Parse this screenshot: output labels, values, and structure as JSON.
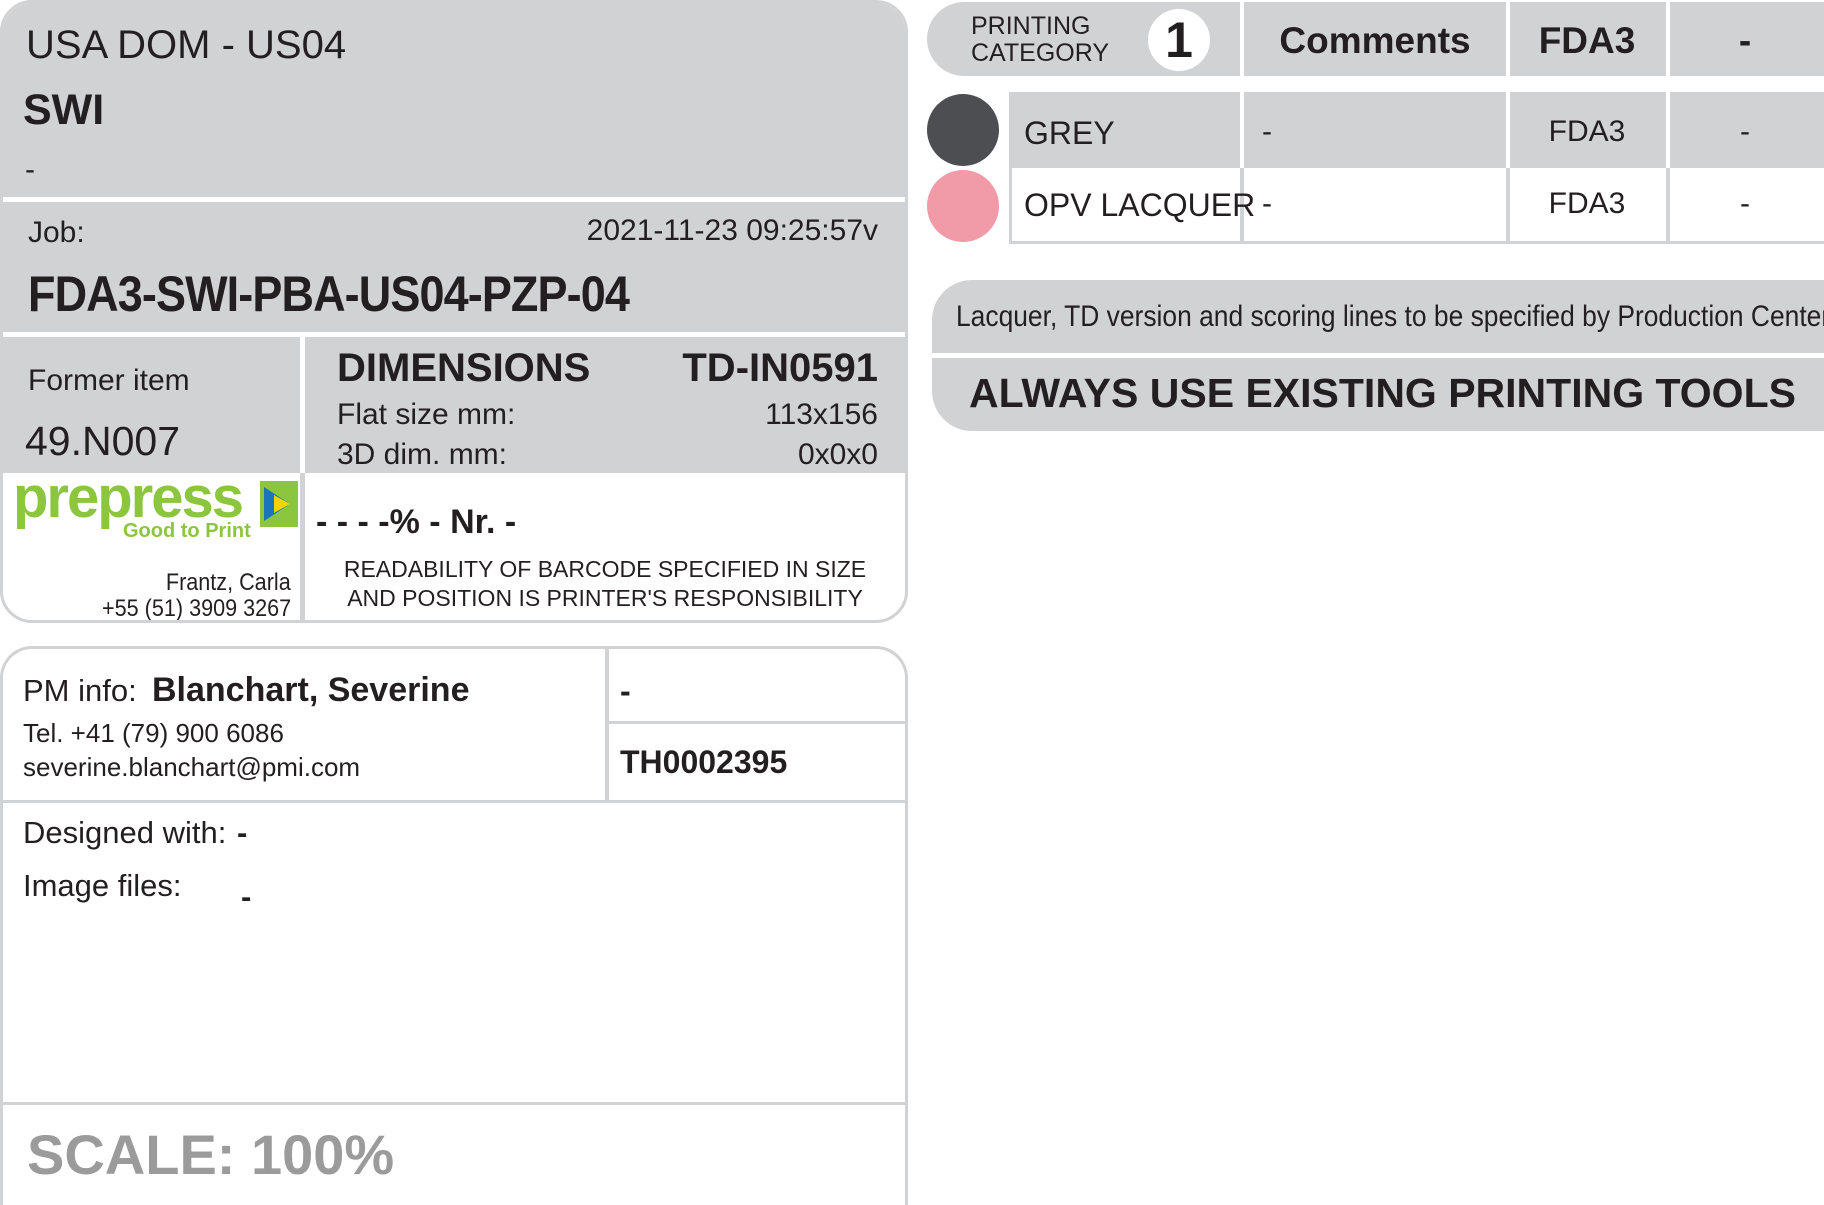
{
  "header": {
    "region": "USA DOM - US04",
    "brand": "SWI",
    "subtitle": "-"
  },
  "job": {
    "label": "Job:",
    "timestamp": "2021-11-23 09:25:57v",
    "code": "FDA3-SWI-PBA-US04-PZP-04"
  },
  "former_item": {
    "label": "Former item",
    "value": "49.N007"
  },
  "dimensions": {
    "title": "DIMENSIONS",
    "td_code": "TD-IN0591",
    "flat_label": "Flat size mm:",
    "flat_value": "113x156",
    "dim3d_label": "3D dim. mm:",
    "dim3d_value": "0x0x0"
  },
  "logo": {
    "word": "prepress",
    "tagline": "Good to Print",
    "brand_green": "#8cc63f",
    "brand_blue": "#1a75bb",
    "brand_yellow": "#f2d500"
  },
  "contact": {
    "name": "Frantz, Carla",
    "phone": "+55 (51) 3909 3267"
  },
  "barcode": {
    "spec": "- - - -% - Nr. -",
    "note_line1": "READABILITY OF BARCODE SPECIFIED IN SIZE",
    "note_line2": "AND POSITION IS PRINTER'S RESPONSIBILITY"
  },
  "pm": {
    "label": "PM info:",
    "name": "Blanchart, Severine",
    "tel": "Tel. +41 (79) 900 6086",
    "email": "severine.blanchart@pmi.com",
    "field1": "-",
    "field2": "TH0002395"
  },
  "design": {
    "designed_label": "Designed with:",
    "designed_value": "-",
    "image_label": "Image files:",
    "image_value": "-"
  },
  "scale": {
    "text": "SCALE: 100%"
  },
  "printing": {
    "category_line1": "PRINTING",
    "category_line2": "CATEGORY",
    "category_number": "1",
    "comments_header": "Comments",
    "fda_header": "FDA3",
    "last_header": "-",
    "colors": [
      {
        "name": "GREY",
        "swatch": "#4d4e52",
        "comment": "-",
        "fda": "FDA3",
        "last": "-"
      },
      {
        "name": "OPV LACQUER",
        "swatch": "#f19aa8",
        "comment": "-",
        "fda": "FDA3",
        "last": "-"
      }
    ]
  },
  "notices": {
    "line1": "Lacquer, TD version and scoring lines to be specified by Production Center",
    "line2": "ALWAYS USE EXISTING PRINTING TOOLS"
  }
}
